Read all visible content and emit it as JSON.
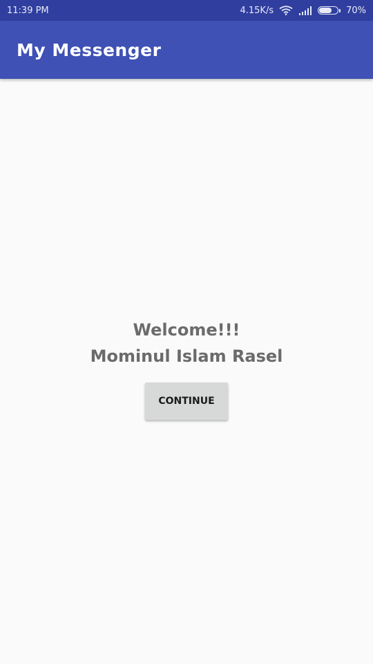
{
  "status_bar": {
    "time": "11:39 PM",
    "network_speed": "4.15K/s",
    "battery_percent_label": "70%",
    "battery_level": 0.7,
    "icons": [
      "wifi-icon",
      "signal-icon",
      "battery-icon"
    ]
  },
  "app_bar": {
    "title": "My Messenger",
    "color": "#3f51b5"
  },
  "welcome": {
    "greeting": "Welcome!!!",
    "user_name": "Mominul Islam Rasel"
  },
  "actions": {
    "continue_label": "CONTINUE"
  },
  "colors": {
    "status_bar": "#303f9f",
    "primary": "#3f51b5",
    "background": "#fafafa",
    "text": "#6b6b6b",
    "button": "#d7d8d8"
  }
}
